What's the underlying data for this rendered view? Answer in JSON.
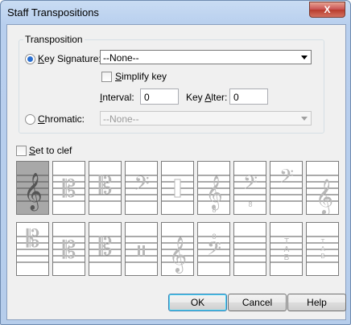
{
  "window": {
    "title": "Staff Transpositions",
    "close_label": "X"
  },
  "transposition": {
    "group_label": "Transposition",
    "key_signature": {
      "label": "Key Signature:",
      "selected": true,
      "value": "--None--"
    },
    "simplify_key": {
      "label": "Simplify key",
      "checked": false
    },
    "interval": {
      "label": "Interval:",
      "value": "0"
    },
    "key_alter": {
      "label": "Key Alter:",
      "value": "0"
    },
    "chromatic": {
      "label": "Chromatic:",
      "selected": false,
      "value": "--None--"
    }
  },
  "set_to_clef": {
    "label": "Set to clef",
    "checked": false
  },
  "clefs": {
    "row1": [
      "treble-clef",
      "alto-c-clef",
      "tenor-c-clef",
      "bass-f-clef",
      "percussion-clef",
      "treble-8va-clef",
      "bass-8vb-clef",
      "bass-high-clef",
      "treble-low-clef"
    ],
    "row2": [
      "c-clef-high",
      "c-clef-mid",
      "c-clef-low",
      "percussion-bars-clef",
      "treble-ghost-clef",
      "bass-8va-clef",
      "blank-clef",
      "tab-clef",
      "tab-small-clef"
    ],
    "selected_index": 0,
    "tab_text": [
      "T",
      "A",
      "B"
    ]
  },
  "buttons": {
    "ok": "OK",
    "cancel": "Cancel",
    "help": "Help"
  }
}
